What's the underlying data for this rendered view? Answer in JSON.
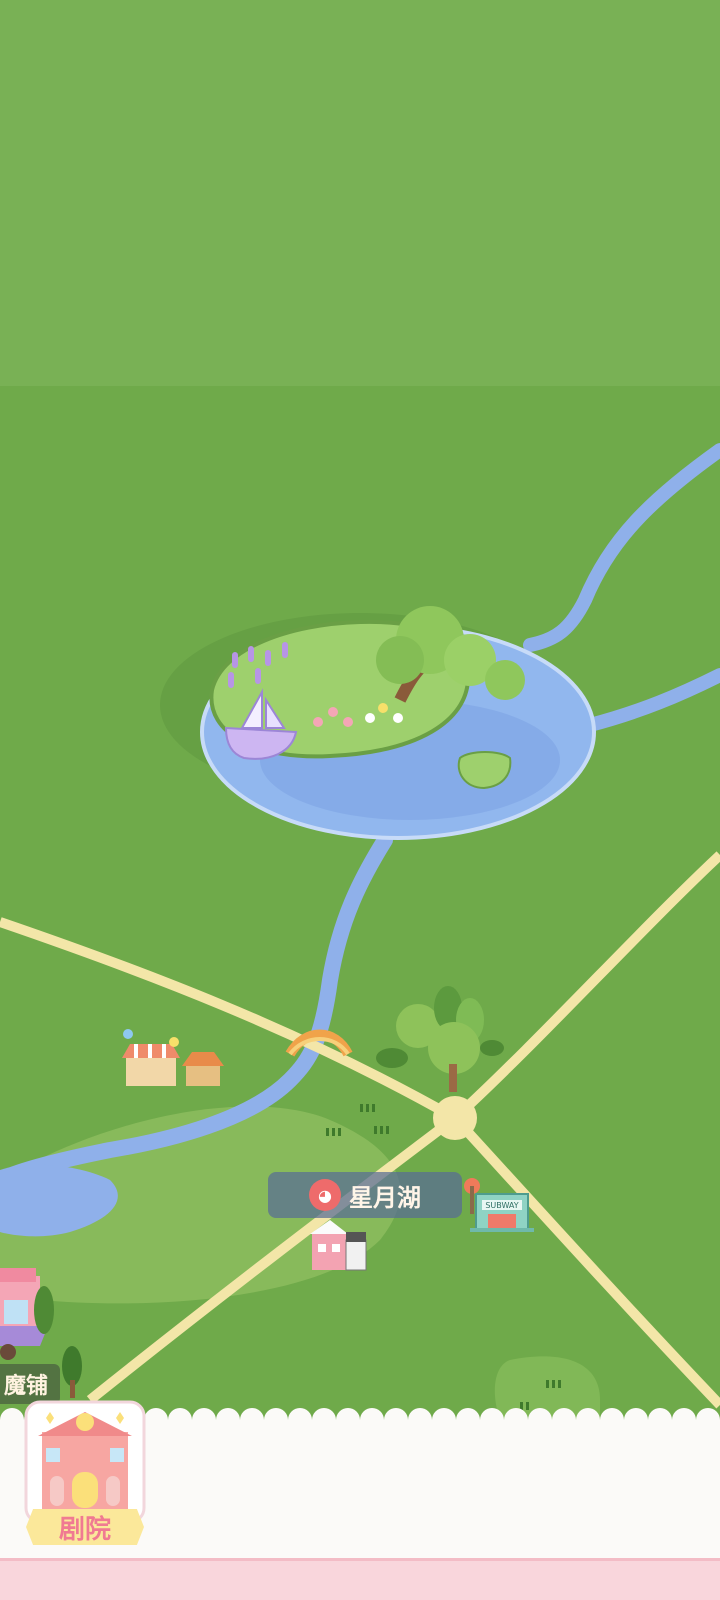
{
  "map": {
    "lake_name": "星月湖",
    "lake_icon": "theater-mask-icon",
    "shop_label": "魔铺",
    "subway_sign": "SUBWAY"
  },
  "bottom_panel": {
    "theater_label": "剧院",
    "theater_icon": "theater-building-icon"
  },
  "colors": {
    "grass": "#6faa4a",
    "top_band": "#79b155",
    "river": "#8fb0ea",
    "road": "#f3e6a8",
    "lake_label_bg": "#586c96",
    "accent_pink": "#f07a92",
    "panel_bg": "#fbfaf8",
    "bottom_bar": "#f9d6dc"
  }
}
